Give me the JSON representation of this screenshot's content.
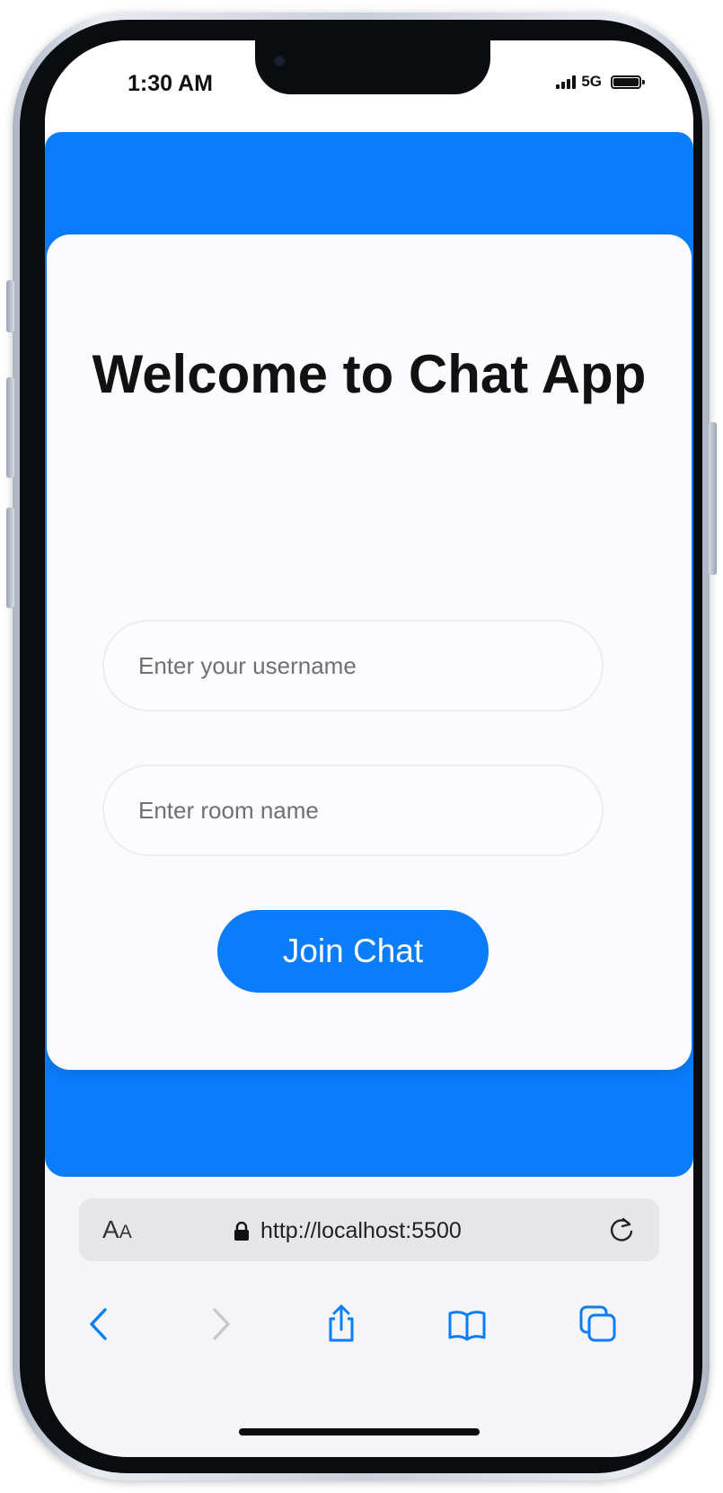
{
  "status_bar": {
    "time": "1:30 AM",
    "network": "5G"
  },
  "page": {
    "title": "Welcome to Chat App",
    "username": {
      "value": "",
      "placeholder": "Enter your username"
    },
    "room": {
      "value": "",
      "placeholder": "Enter room name"
    },
    "join_label": "Join Chat"
  },
  "browser": {
    "text_size_big": "A",
    "text_size_small": "A",
    "url": "http://localhost:5500"
  },
  "icons": {
    "back": "chevron-left-icon",
    "forward": "chevron-right-icon",
    "share": "share-icon",
    "bookmarks": "book-icon",
    "tabs": "tabs-icon",
    "reload": "reload-icon",
    "lock": "lock-icon"
  },
  "colors": {
    "accent": "#0a7dfb",
    "card": "#fbfaff",
    "browser_chrome": "#f5f5f7",
    "inactive_icon": "#c7c7cc"
  }
}
